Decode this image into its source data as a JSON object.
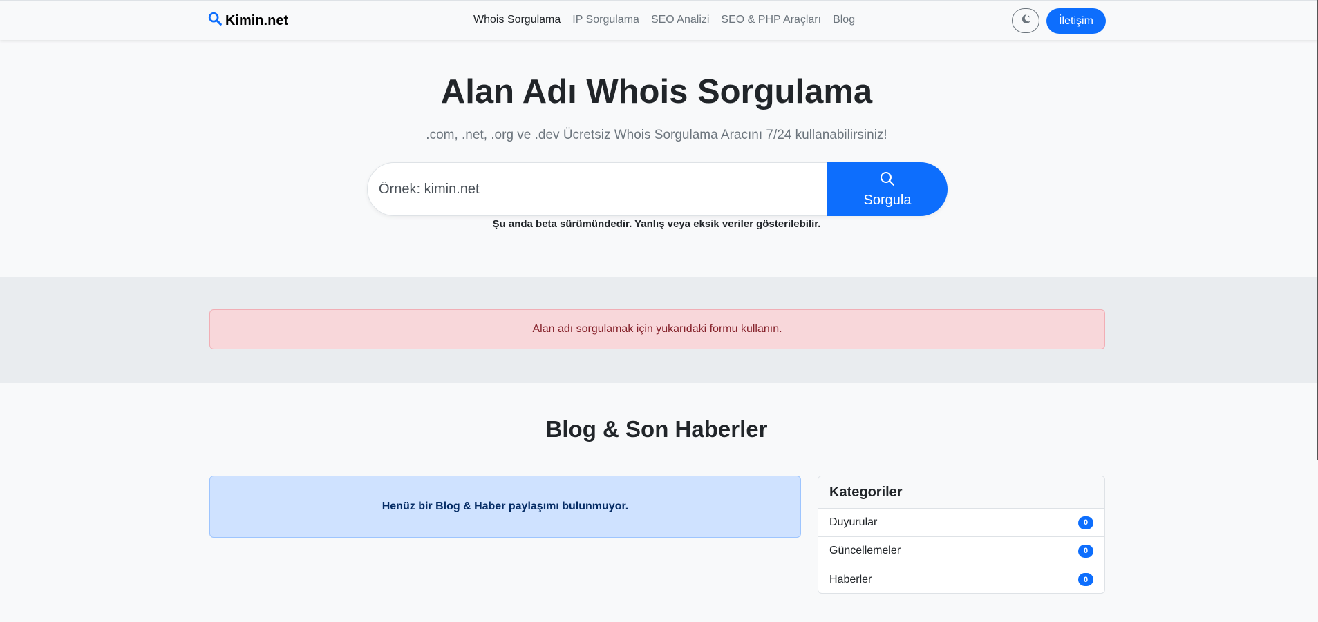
{
  "navbar": {
    "brand": "Kimin.net",
    "links": [
      "Whois Sorgulama",
      "IP Sorgulama",
      "SEO Analizi",
      "SEO & PHP Araçları",
      "Blog"
    ],
    "active_index": 0,
    "theme_icon": "moon-icon",
    "contact_label": "İletişim"
  },
  "hero": {
    "title": "Alan Adı Whois Sorgulama",
    "subtitle": ".com, .net, .org ve .dev Ücretsiz Whois Sorgulama Aracını 7/24 kullanabilirsiniz!",
    "search_placeholder": "Örnek: kimin.net",
    "search_value": "",
    "search_button": "Sorgula",
    "beta_note": "Şu anda beta sürümündedir. Yanlış veya eksik veriler gösterilebilir."
  },
  "alert": {
    "message": "Alan adı sorgulamak için yukarıdaki formu kullanın."
  },
  "blog": {
    "title": "Blog & Son Haberler",
    "empty_message": "Henüz bir Blog & Haber paylaşımı bulunmuyor."
  },
  "categories": {
    "title": "Kategoriler",
    "items": [
      {
        "label": "Duyurular",
        "count": "0"
      },
      {
        "label": "Güncellemeler",
        "count": "0"
      },
      {
        "label": "Haberler",
        "count": "0"
      }
    ]
  },
  "colors": {
    "primary": "#0d6efd",
    "danger_bg": "#f8d7da",
    "info_bg": "#cfe2ff",
    "band_bg": "#e9ecef"
  }
}
